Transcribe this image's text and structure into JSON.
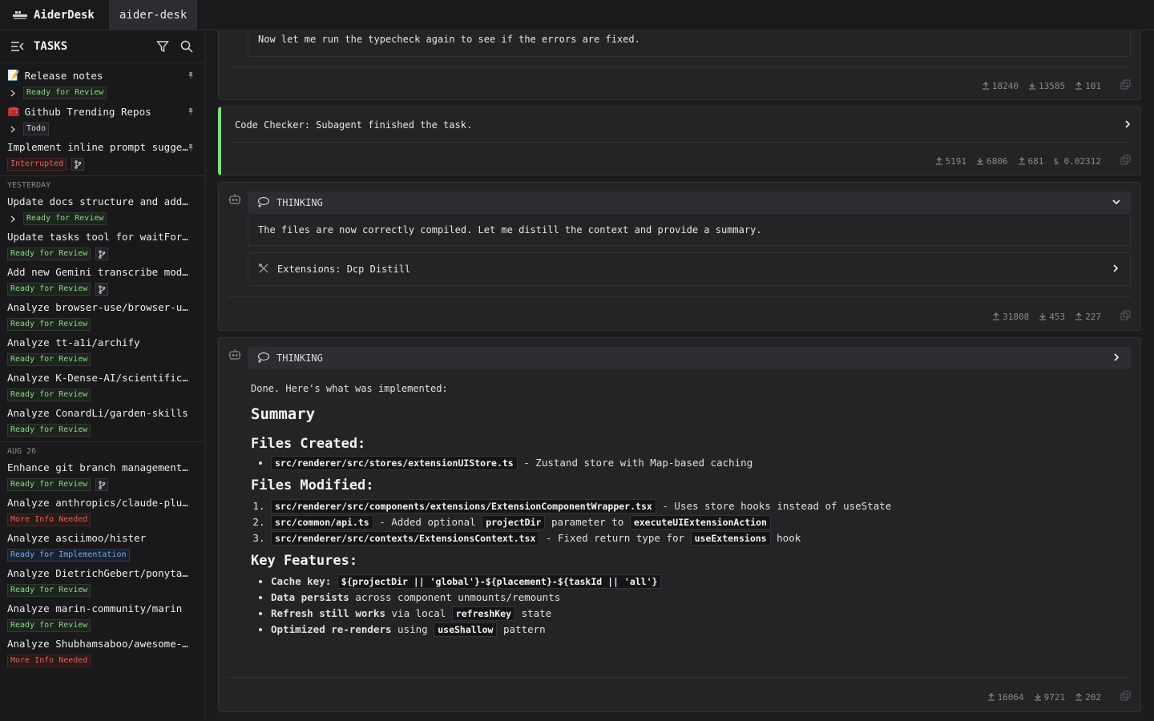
{
  "app": {
    "name": "AiderDesk",
    "tab": "aider-desk"
  },
  "sidebar": {
    "title": "TASKS",
    "groups": [
      {
        "label": "",
        "tasks": [
          {
            "icon": "📝",
            "name": "Release notes",
            "status": "Ready for Review",
            "status_kind": "green",
            "pinned": true,
            "expand": true,
            "branch": false
          },
          {
            "icon": "🧰",
            "name": "Github Trending Repos",
            "status": "Todo",
            "status_kind": "todo",
            "pinned": true,
            "expand": true,
            "branch": false
          },
          {
            "icon": "",
            "name": "Implement inline prompt sugge…",
            "status": "Interrupted",
            "status_kind": "red",
            "pinned": true,
            "expand": false,
            "branch": true
          }
        ]
      },
      {
        "label": "YESTERDAY",
        "tasks": [
          {
            "icon": "",
            "name": "Update docs structure and add i…",
            "status": "Ready for Review",
            "status_kind": "green",
            "pinned": false,
            "expand": true,
            "branch": false
          },
          {
            "icon": "",
            "name": "Update tasks tool for waitForFi…",
            "status": "Ready for Review",
            "status_kind": "green",
            "pinned": false,
            "expand": false,
            "branch": true
          },
          {
            "icon": "",
            "name": "Add new Gemini transcribe model…",
            "status": "Ready for Review",
            "status_kind": "green",
            "pinned": false,
            "expand": false,
            "branch": true
          },
          {
            "icon": "",
            "name": "Analyze browser-use/browser-use",
            "status": "Ready for Review",
            "status_kind": "green",
            "pinned": false,
            "expand": false,
            "branch": false
          },
          {
            "icon": "",
            "name": "Analyze tt-a1i/archify",
            "status": "Ready for Review",
            "status_kind": "green",
            "pinned": false,
            "expand": false,
            "branch": false
          },
          {
            "icon": "",
            "name": "Analyze K-Dense-AI/scientific-a…",
            "status": "Ready for Review",
            "status_kind": "green",
            "pinned": false,
            "expand": false,
            "branch": false
          },
          {
            "icon": "",
            "name": "Analyze ConardLi/garden-skills",
            "status": "Ready for Review",
            "status_kind": "green",
            "pinned": false,
            "expand": false,
            "branch": false
          }
        ]
      },
      {
        "label": "AUG 26",
        "tasks": [
          {
            "icon": "",
            "name": "Enhance git branch management f…",
            "status": "Ready for Review",
            "status_kind": "green",
            "pinned": false,
            "expand": false,
            "branch": true
          },
          {
            "icon": "",
            "name": "Analyze anthropics/claude-plugi…",
            "status": "More Info Needed",
            "status_kind": "red",
            "pinned": false,
            "expand": false,
            "branch": false
          },
          {
            "icon": "",
            "name": "Analyze asciimoo/hister",
            "status": "Ready for Implementation",
            "status_kind": "blue",
            "pinned": false,
            "expand": false,
            "branch": false
          },
          {
            "icon": "",
            "name": "Analyze DietrichGebert/ponytail",
            "status": "Ready for Review",
            "status_kind": "green",
            "pinned": false,
            "expand": false,
            "branch": false
          },
          {
            "icon": "",
            "name": "Analyze marin-community/marin",
            "status": "Ready for Review",
            "status_kind": "green",
            "pinned": false,
            "expand": false,
            "branch": false
          },
          {
            "icon": "",
            "name": "Analyze Shubhamsaboo/awesome-ll…",
            "status": "More Info Needed",
            "status_kind": "red",
            "pinned": false,
            "expand": false,
            "branch": false
          }
        ]
      }
    ]
  },
  "messages": {
    "m1": {
      "text": "Now let me run the typecheck again to see if the errors are fixed.",
      "stats": [
        "18240",
        "13585",
        "101"
      ]
    },
    "m2": {
      "text": "Code Checker: Subagent finished the task.",
      "stats": [
        "5191",
        "6806",
        "681",
        "$ 0.02312"
      ]
    },
    "m3": {
      "thinking_label": "THINKING",
      "text": "The files are now correctly compiled. Let me distill the context and provide a summary.",
      "tool": "Extensions: Dcp Distill",
      "stats": [
        "31808",
        "453",
        "227"
      ]
    },
    "m4": {
      "thinking_label": "THINKING",
      "intro": "Done. Here's what was implemented:",
      "h_summary": "Summary",
      "h_created": "Files Created:",
      "created": [
        {
          "code": "src/renderer/src/stores/extensionUIStore.ts",
          "text": "- Zustand store with Map-based caching"
        }
      ],
      "h_modified": "Files Modified:",
      "modified": [
        {
          "code": "src/renderer/src/components/extensions/ExtensionComponentWrapper.tsx",
          "text": "- Uses store hooks instead of useState"
        },
        {
          "code": "src/common/api.ts",
          "text": "- Added optional",
          "code2": "projectDir",
          "text2": "parameter to",
          "code3": "executeUIExtensionAction"
        },
        {
          "code": "src/renderer/src/contexts/ExtensionsContext.tsx",
          "text": "- Fixed return type for",
          "code2": "useExtensions",
          "text2": "hook"
        }
      ],
      "h_features": "Key Features:",
      "features": [
        {
          "bold": "Cache key:",
          "code": "${projectDir || 'global'}-${placement}-${taskId || 'all'}",
          "text": ""
        },
        {
          "bold": "Data persists",
          "text": "across component unmounts/remounts"
        },
        {
          "bold": "Refresh still works",
          "text": "via local",
          "code": "refreshKey",
          "text2": "state"
        },
        {
          "bold": "Optimized re-renders",
          "text": "using",
          "code": "useShallow",
          "text2": "pattern"
        }
      ],
      "stats": [
        "16064",
        "9721",
        "202"
      ]
    }
  },
  "colors": {
    "accent_green": "#7ee07e",
    "bg": "#1c1c1e",
    "card": "#242427"
  }
}
